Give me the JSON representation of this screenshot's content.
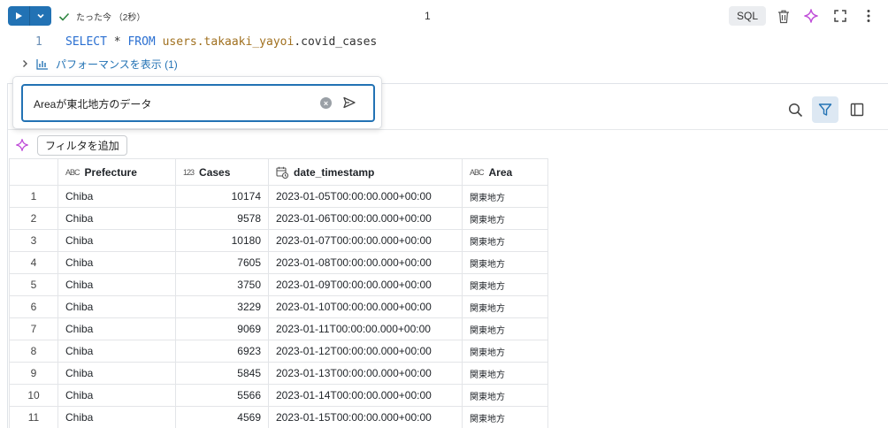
{
  "toolbar": {
    "status_text": "たった今 （2秒）",
    "cell_number": "1",
    "language_badge": "SQL",
    "icons": [
      "run-icon",
      "chevron-down-icon",
      "check-icon",
      "trash-icon",
      "sparkle-icon",
      "fullscreen-icon",
      "more-vertical-icon"
    ]
  },
  "code": {
    "line_number": "1",
    "keyword_select": "SELECT",
    "star": " * ",
    "keyword_from": "FROM",
    "table_path": "users.takaaki_yayoi",
    "table_suffix": ".covid_cases"
  },
  "performance": {
    "label": "パフォーマンスを表示 (1)"
  },
  "ai_prompt": {
    "text": "Areaが東北地方のデータ"
  },
  "filter": {
    "add_label": "フィルタを追加"
  },
  "table": {
    "columns": [
      {
        "type_icon": "ABC",
        "label": "Prefecture"
      },
      {
        "type_icon": "123",
        "label": "Cases"
      },
      {
        "type_icon": "calendar-clock-icon",
        "label": "date_timestamp"
      },
      {
        "type_icon": "ABC",
        "label": "Area"
      }
    ],
    "rows": [
      {
        "idx": "1",
        "prefecture": "Chiba",
        "cases": "10174",
        "date": "2023-01-05T00:00:00.000+00:00",
        "area": "関東地方"
      },
      {
        "idx": "2",
        "prefecture": "Chiba",
        "cases": "9578",
        "date": "2023-01-06T00:00:00.000+00:00",
        "area": "関東地方"
      },
      {
        "idx": "3",
        "prefecture": "Chiba",
        "cases": "10180",
        "date": "2023-01-07T00:00:00.000+00:00",
        "area": "関東地方"
      },
      {
        "idx": "4",
        "prefecture": "Chiba",
        "cases": "7605",
        "date": "2023-01-08T00:00:00.000+00:00",
        "area": "関東地方"
      },
      {
        "idx": "5",
        "prefecture": "Chiba",
        "cases": "3750",
        "date": "2023-01-09T00:00:00.000+00:00",
        "area": "関東地方"
      },
      {
        "idx": "6",
        "prefecture": "Chiba",
        "cases": "3229",
        "date": "2023-01-10T00:00:00.000+00:00",
        "area": "関東地方"
      },
      {
        "idx": "7",
        "prefecture": "Chiba",
        "cases": "9069",
        "date": "2023-01-11T00:00:00.000+00:00",
        "area": "関東地方"
      },
      {
        "idx": "8",
        "prefecture": "Chiba",
        "cases": "6923",
        "date": "2023-01-12T00:00:00.000+00:00",
        "area": "関東地方"
      },
      {
        "idx": "9",
        "prefecture": "Chiba",
        "cases": "5845",
        "date": "2023-01-13T00:00:00.000+00:00",
        "area": "関東地方"
      },
      {
        "idx": "10",
        "prefecture": "Chiba",
        "cases": "5566",
        "date": "2023-01-14T00:00:00.000+00:00",
        "area": "関東地方"
      },
      {
        "idx": "11",
        "prefecture": "Chiba",
        "cases": "4569",
        "date": "2023-01-15T00:00:00.000+00:00",
        "area": "関東地方"
      }
    ]
  },
  "colors": {
    "accent": "#2272b4",
    "sql_keyword": "#2a6fd1",
    "table_name": "#a0701f",
    "sparkle": "#c04fd9"
  }
}
